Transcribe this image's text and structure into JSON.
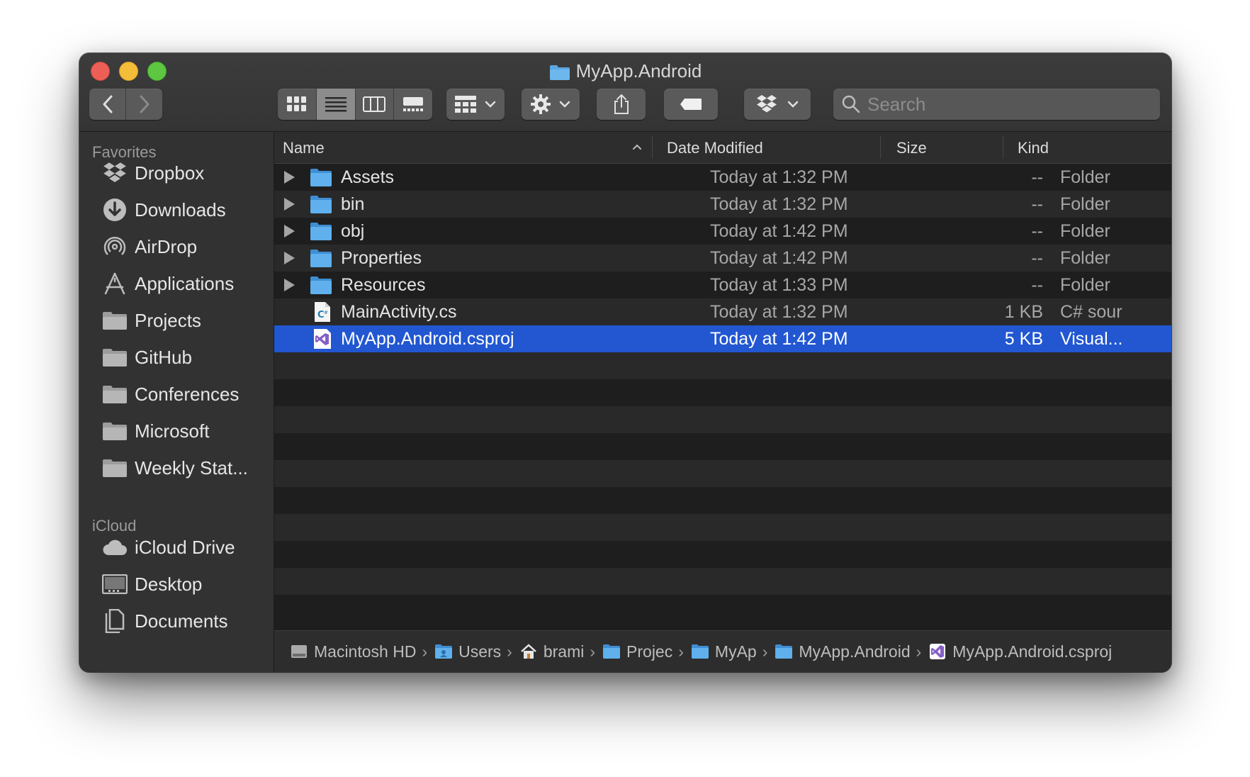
{
  "window": {
    "title": "MyApp.Android"
  },
  "toolbar": {
    "back_icon": "chevron-left-icon",
    "forward_icon": "chevron-right-icon",
    "view_modes": [
      "icon-view",
      "list-view",
      "column-view",
      "gallery-view"
    ],
    "active_view": "list-view",
    "search_placeholder": "Search"
  },
  "sidebar": {
    "favorites_heading": "Favorites",
    "favorites": [
      {
        "label": "Dropbox",
        "icon": "dropbox-icon"
      },
      {
        "label": "Downloads",
        "icon": "downloads-icon"
      },
      {
        "label": "AirDrop",
        "icon": "airdrop-icon"
      },
      {
        "label": "Applications",
        "icon": "applications-icon"
      },
      {
        "label": "Projects",
        "icon": "folder-icon"
      },
      {
        "label": "GitHub",
        "icon": "folder-icon"
      },
      {
        "label": "Conferences",
        "icon": "folder-icon"
      },
      {
        "label": "Microsoft",
        "icon": "folder-icon"
      },
      {
        "label": "Weekly Stat...",
        "icon": "folder-icon"
      }
    ],
    "icloud_heading": "iCloud",
    "icloud": [
      {
        "label": "iCloud Drive",
        "icon": "cloud-icon"
      },
      {
        "label": "Desktop",
        "icon": "desktop-icon"
      },
      {
        "label": "Documents",
        "icon": "documents-icon"
      }
    ]
  },
  "columns": {
    "name": "Name",
    "date": "Date Modified",
    "size": "Size",
    "kind": "Kind",
    "sort_indicator": "^"
  },
  "files": [
    {
      "name": "Assets",
      "date": "Today at 1:32 PM",
      "size": "--",
      "kind": "Folder",
      "type": "folder"
    },
    {
      "name": "bin",
      "date": "Today at 1:32 PM",
      "size": "--",
      "kind": "Folder",
      "type": "folder"
    },
    {
      "name": "obj",
      "date": "Today at 1:42 PM",
      "size": "--",
      "kind": "Folder",
      "type": "folder"
    },
    {
      "name": "Properties",
      "date": "Today at 1:42 PM",
      "size": "--",
      "kind": "Folder",
      "type": "folder"
    },
    {
      "name": "Resources",
      "date": "Today at 1:33 PM",
      "size": "--",
      "kind": "Folder",
      "type": "folder"
    },
    {
      "name": "MainActivity.cs",
      "date": "Today at 1:32 PM",
      "size": "1 KB",
      "kind": "C# sour",
      "type": "csharp"
    },
    {
      "name": "MyApp.Android.csproj",
      "date": "Today at 1:42 PM",
      "size": "5 KB",
      "kind": "Visual...",
      "type": "vs",
      "selected": true
    }
  ],
  "pathbar": [
    {
      "label": "Macintosh HD",
      "icon": "hard-drive-icon"
    },
    {
      "label": "Users",
      "icon": "folder-users-icon"
    },
    {
      "label": "brami",
      "icon": "home-icon"
    },
    {
      "label": "Projec",
      "icon": "folder-icon"
    },
    {
      "label": "MyAp",
      "icon": "folder-icon"
    },
    {
      "label": "MyApp.Android",
      "icon": "folder-icon"
    },
    {
      "label": "MyApp.Android.csproj",
      "icon": "visual-studio-icon"
    }
  ],
  "colors": {
    "selection": "#2257d1",
    "folder_blue": "#5aa7e0",
    "vs_purple": "#865fc5"
  }
}
